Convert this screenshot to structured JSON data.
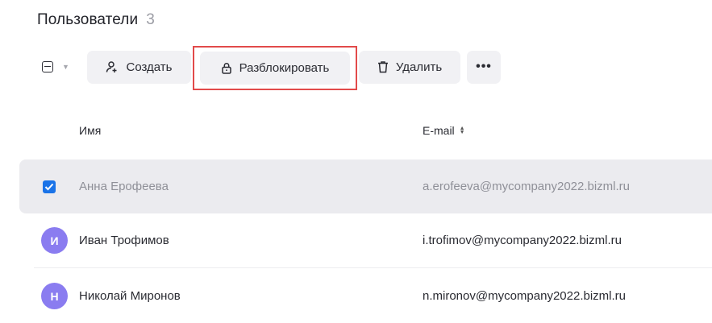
{
  "header": {
    "title": "Пользователи",
    "count": "3"
  },
  "toolbar": {
    "create_label": "Создать",
    "unblock_label": "Разблокировать",
    "delete_label": "Удалить",
    "more_label": "•••",
    "highlight_color": "#e24a4a"
  },
  "table": {
    "columns": {
      "name": "Имя",
      "email": "E-mail"
    },
    "rows": [
      {
        "initial": "",
        "name": "Анна Ерофеева",
        "email": "a.erofeeva@mycompany2022.bizml.ru",
        "selected": true
      },
      {
        "initial": "И",
        "name": "Иван Трофимов",
        "email": "i.trofimov@mycompany2022.bizml.ru",
        "selected": false
      },
      {
        "initial": "Н",
        "name": "Николай Миронов",
        "email": "n.mironov@mycompany2022.bizml.ru",
        "selected": false
      }
    ]
  },
  "colors": {
    "avatar": "#8a7cf0",
    "checkbox": "#1a73e8",
    "selected_row": "#ebebef"
  }
}
